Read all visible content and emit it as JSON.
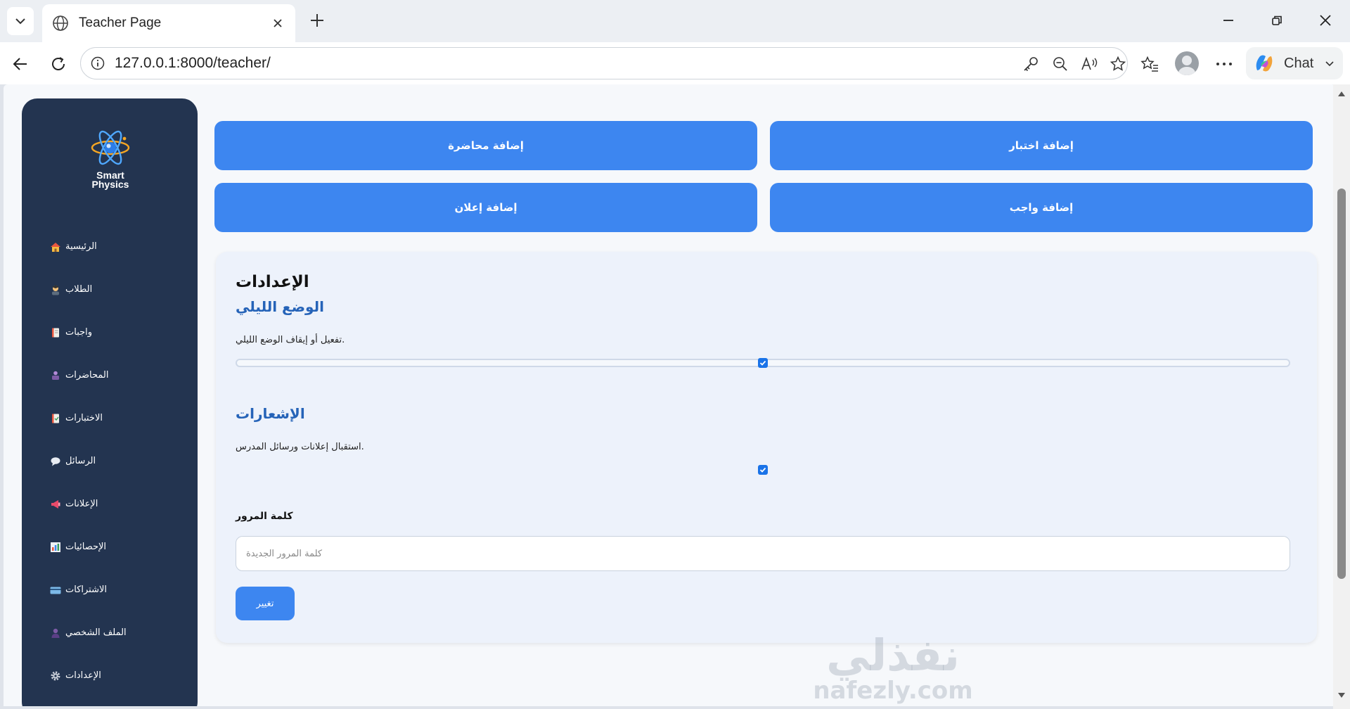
{
  "browser": {
    "tab_title": "Teacher Page",
    "url": "127.0.0.1:8000/teacher/",
    "chat_label": "Chat"
  },
  "sidebar": {
    "logo_line1": "Smart",
    "logo_line2": "Physics",
    "items": [
      {
        "label": "الرئيسية",
        "icon": "house-icon"
      },
      {
        "label": "الطلاب",
        "icon": "student-icon"
      },
      {
        "label": "واجبات",
        "icon": "notebook-icon"
      },
      {
        "label": "المحاضرات",
        "icon": "classroom-icon"
      },
      {
        "label": "الاختبارات",
        "icon": "exam-icon"
      },
      {
        "label": "الرسائل",
        "icon": "chat-bubble-icon"
      },
      {
        "label": "الإعلانات",
        "icon": "megaphone-icon"
      },
      {
        "label": "الإحصائيات",
        "icon": "bar-chart-icon"
      },
      {
        "label": "الاشتراكات",
        "icon": "credit-card-icon"
      },
      {
        "label": "الملف الشخصي",
        "icon": "person-icon"
      },
      {
        "label": "الإعدادات",
        "icon": "gear-icon"
      }
    ]
  },
  "actions": {
    "add_lecture": "إضافة محاضرة",
    "add_exam": "إضافة اختبار",
    "add_announcement": "إضافة إعلان",
    "add_homework": "إضافة واجب"
  },
  "settings": {
    "title": "الإعدادات",
    "dark_mode_heading": "الوضع الليلي",
    "dark_mode_desc": "تفعيل أو إيقاف الوضع الليلي.",
    "notifications_heading": "الإشعارات",
    "notifications_desc": "استقبال إعلانات ورسائل المدرس.",
    "password_label": "كلمة المرور",
    "password_placeholder": "كلمة المرور الجديدة",
    "change_button": "تغيير"
  },
  "watermark": {
    "ar": "نفذلي",
    "en": "nafezly.com"
  },
  "colors": {
    "sidebar": "#233450",
    "accent": "#3d86f0",
    "heading_blue": "#2563b8"
  }
}
